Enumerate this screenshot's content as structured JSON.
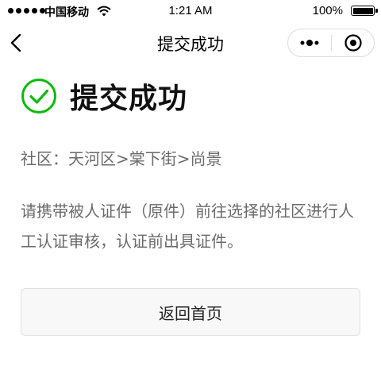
{
  "status_bar": {
    "carrier": "中国移动",
    "time": "1:21 AM",
    "battery": "100%",
    "battery_level": 1.0
  },
  "nav": {
    "title": "提交成功"
  },
  "result": {
    "title": "提交成功",
    "icon": "check-circle-icon",
    "accent_color": "#09bb07",
    "community_label": "社区：",
    "community_value": "天河区>棠下街>尚景",
    "instruction": "请携带被人证件（原件）前往选择的社区进行人工认证审核，认证前出具证件。"
  },
  "actions": {
    "home_label": "返回首页"
  }
}
